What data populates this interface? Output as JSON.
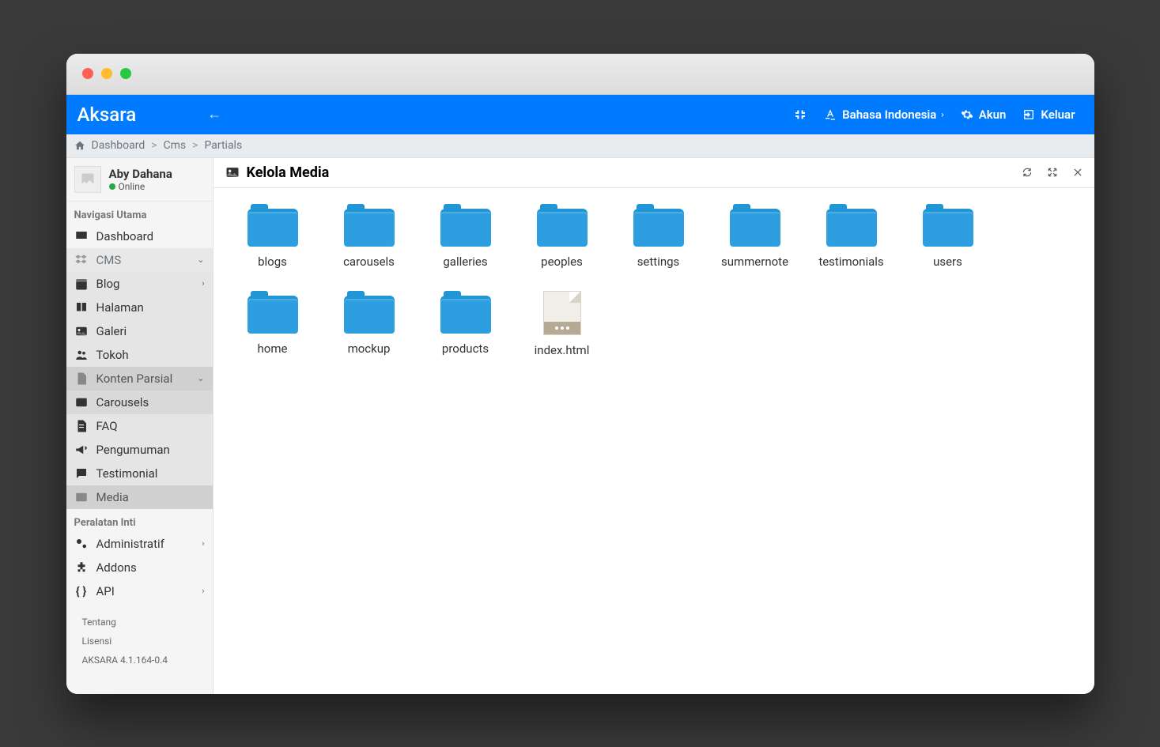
{
  "brand": "Aksara",
  "topbar": {
    "language": "Bahasa Indonesia",
    "account": "Akun",
    "logout": "Keluar"
  },
  "breadcrumb": [
    "Dashboard",
    "Cms",
    "Partials"
  ],
  "user": {
    "name": "Aby Dahana",
    "status": "Online"
  },
  "nav": {
    "header1": "Navigasi Utama",
    "dashboard": "Dashboard",
    "cms": "CMS",
    "blog": "Blog",
    "halaman": "Halaman",
    "galeri": "Galeri",
    "tokoh": "Tokoh",
    "konten_parsial": "Konten Parsial",
    "carousels": "Carousels",
    "faq": "FAQ",
    "pengumuman": "Pengumuman",
    "testimonial": "Testimonial",
    "media": "Media",
    "header2": "Peralatan Inti",
    "administratif": "Administratif",
    "addons": "Addons",
    "api": "API"
  },
  "footer": {
    "about": "Tentang",
    "license": "Lisensi",
    "version": "AKSARA 4.1.164-0.4"
  },
  "content": {
    "title": "Kelola Media"
  },
  "folders": [
    {
      "name": "blogs"
    },
    {
      "name": "carousels"
    },
    {
      "name": "galleries"
    },
    {
      "name": "peoples"
    },
    {
      "name": "settings"
    },
    {
      "name": "summernote"
    },
    {
      "name": "testimonials"
    },
    {
      "name": "users"
    },
    {
      "name": "home"
    },
    {
      "name": "mockup"
    },
    {
      "name": "products"
    }
  ],
  "files": [
    {
      "name": "index.html"
    }
  ]
}
